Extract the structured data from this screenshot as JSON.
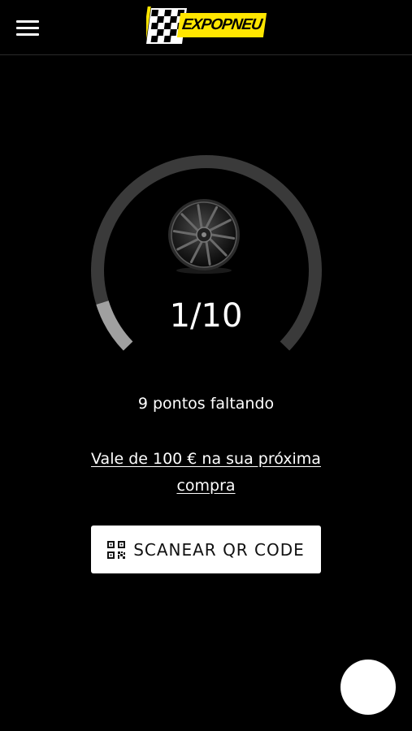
{
  "header": {
    "logo_text": "EXPOPNEU",
    "logo_colors": {
      "box": "#ffe600",
      "text": "#000000"
    }
  },
  "loyalty": {
    "progress_text": "1/10",
    "progress_current": 1,
    "progress_total": 10,
    "points_remaining_text": "9 pontos faltando",
    "reward_text": "Vale de 100 € na sua próxima compra",
    "track_color": "#3a3a3a",
    "fill_color": "#a0a0a0",
    "icon": "wheel-icon"
  },
  "actions": {
    "scan_label": "SCANEAR QR CODE",
    "scan_icon": "qr-code-icon"
  },
  "colors": {
    "background": "#000000",
    "text": "#ffffff",
    "button_bg": "#ffffff",
    "button_text": "#111111"
  }
}
